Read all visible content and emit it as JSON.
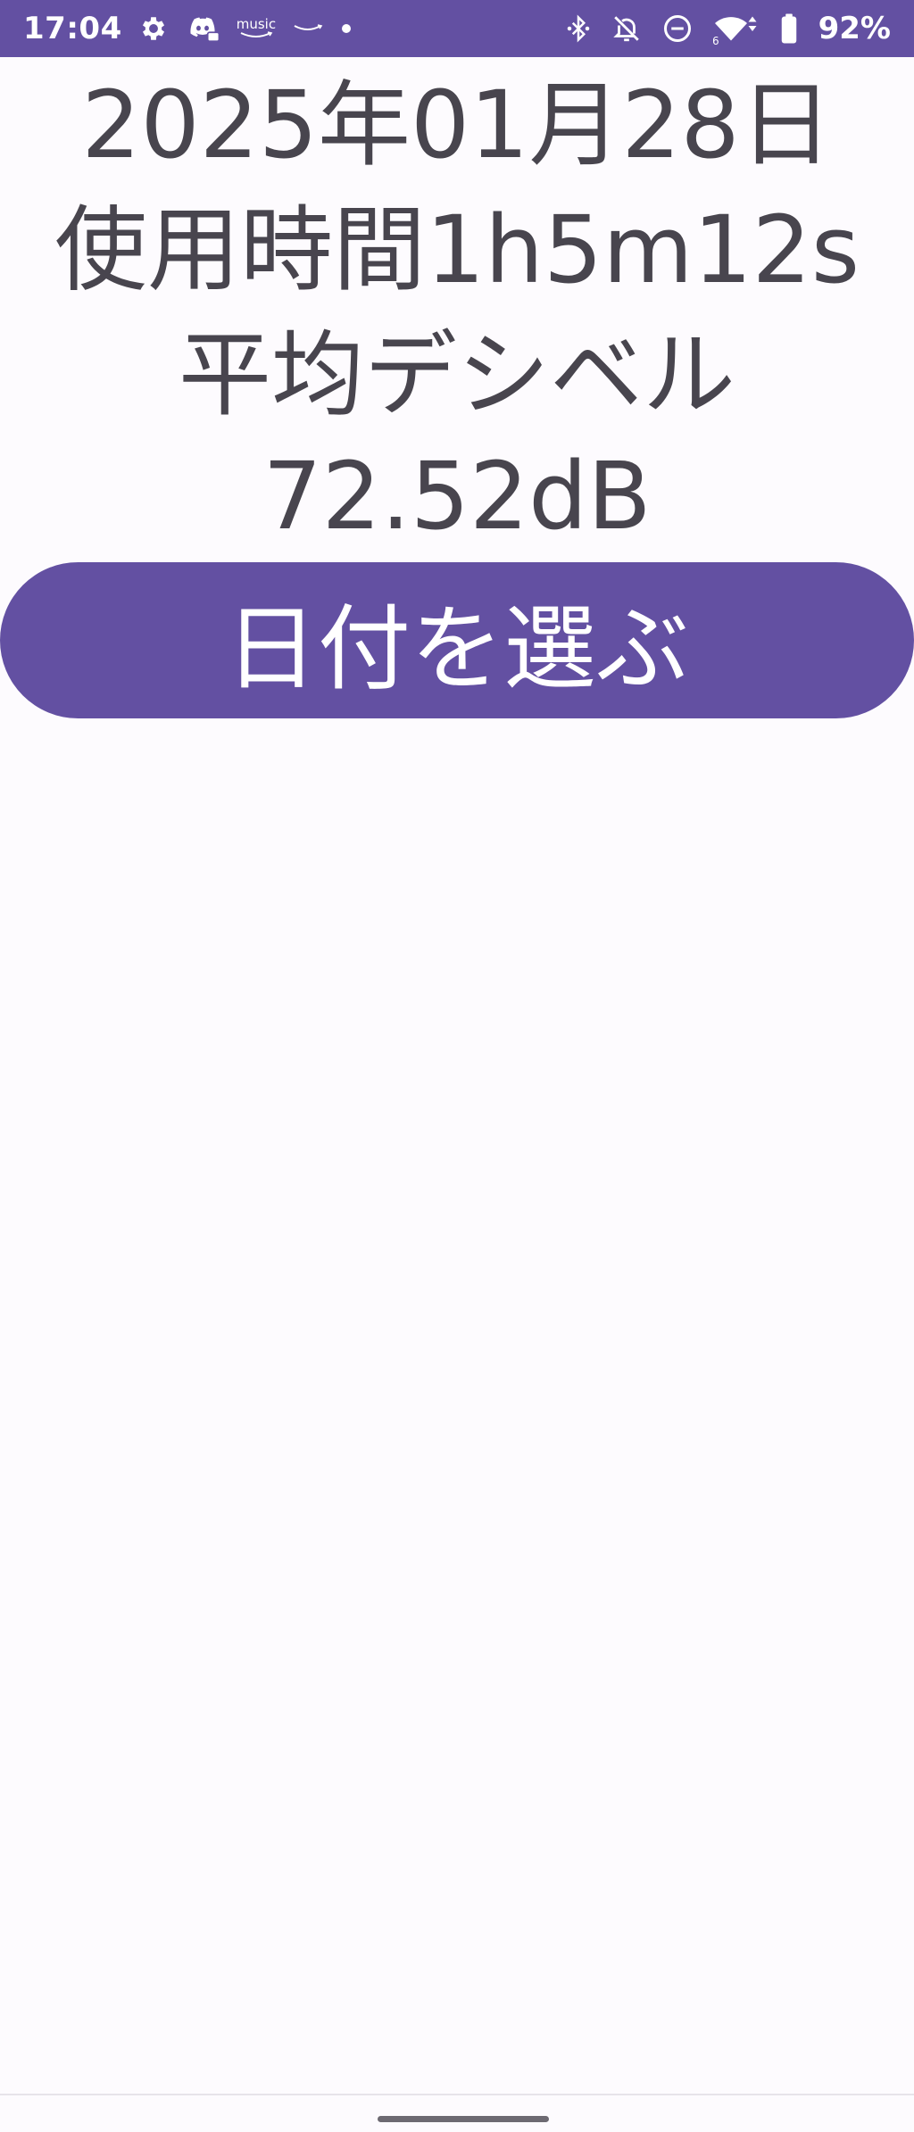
{
  "status_bar": {
    "time": "17:04",
    "music_label": "music",
    "battery_percent": "92%",
    "background_color": "#6350a2",
    "left_icons": [
      "gear-icon",
      "discord-icon",
      "amazon-music-icon",
      "amazon-icon",
      "notification-dot-icon"
    ],
    "right_icons": [
      "bluetooth-icon",
      "bell-off-icon",
      "do-not-disturb-icon",
      "wifi-icon",
      "battery-icon"
    ]
  },
  "main": {
    "date": "2025年01月28日",
    "usage_time": "使用時間1h5m12s",
    "average_label": "平均デシベル",
    "average_value": "72.52dB"
  },
  "actions": {
    "pick_date_label": "日付を選ぶ",
    "accent_color": "#6350a2"
  }
}
